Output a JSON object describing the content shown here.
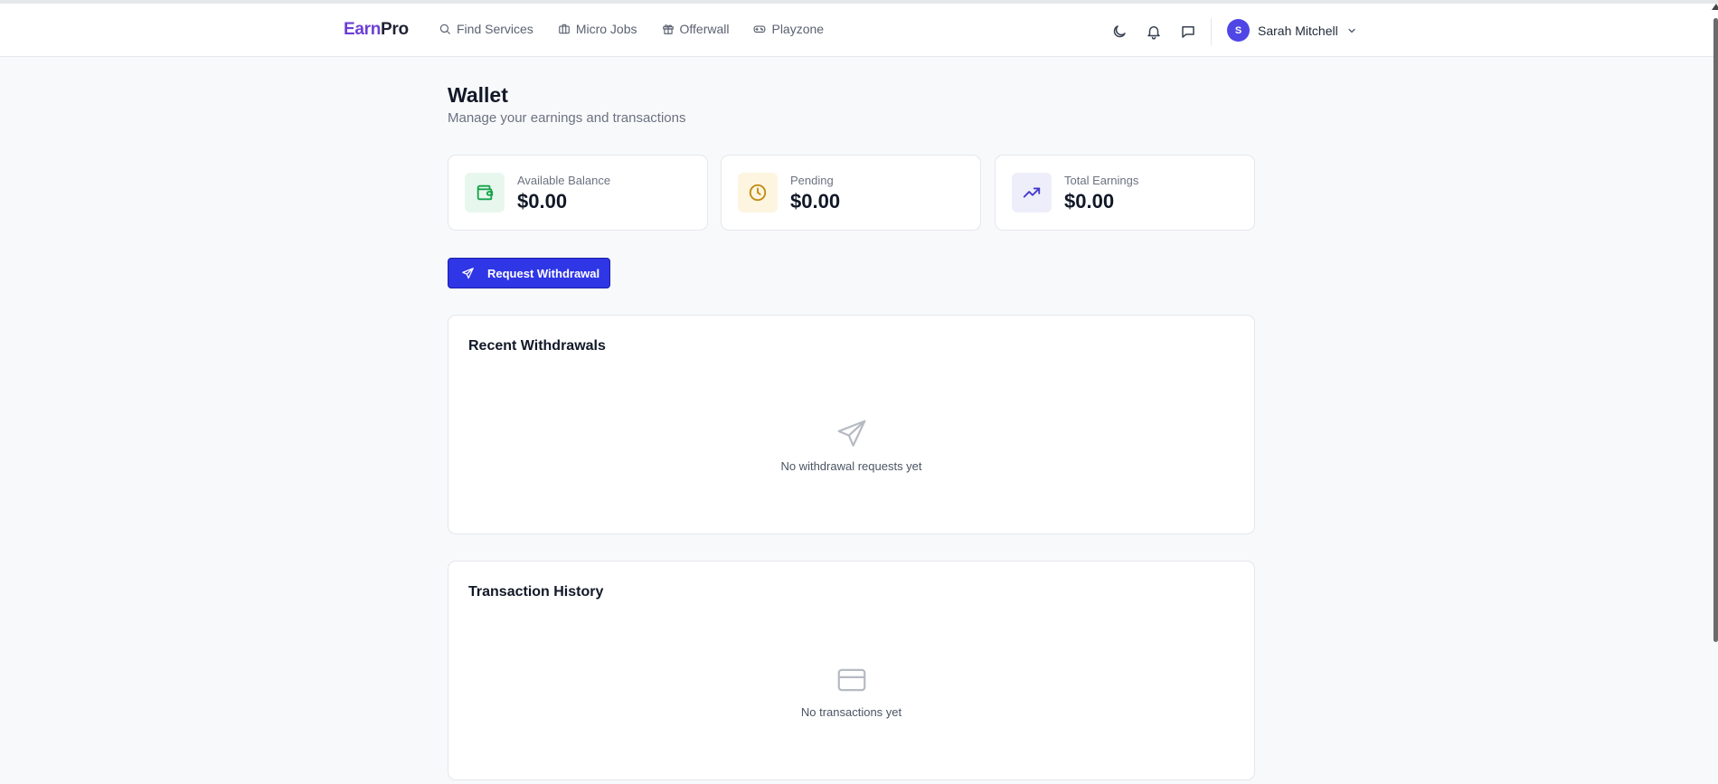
{
  "app": {
    "logo_part1": "Earn",
    "logo_part2": "Pro"
  },
  "nav": [
    {
      "label": "Find Services",
      "icon": "search-icon"
    },
    {
      "label": "Micro Jobs",
      "icon": "briefcase-icon"
    },
    {
      "label": "Offerwall",
      "icon": "gift-icon"
    },
    {
      "label": "Playzone",
      "icon": "gamepad-icon"
    }
  ],
  "header_actions": [
    "moon-icon",
    "bell-icon",
    "message-icon"
  ],
  "user": {
    "initial": "S",
    "name": "Sarah Mitchell"
  },
  "page": {
    "title": "Wallet",
    "subtitle": "Manage your earnings and transactions"
  },
  "stats": [
    {
      "label": "Available Balance",
      "value": "$0.00",
      "icon": "wallet-icon",
      "color": "#16a34a",
      "bg": "#e8f7ee"
    },
    {
      "label": "Pending",
      "value": "$0.00",
      "icon": "clock-icon",
      "color": "#c08a12",
      "bg": "#fdf5e0"
    },
    {
      "label": "Total Earnings",
      "value": "$0.00",
      "icon": "trending-up-icon",
      "color": "#4338ca",
      "bg": "#eeeefb"
    }
  ],
  "withdraw_button": {
    "label": "Request Withdrawal"
  },
  "recent_withdrawals": {
    "title": "Recent Withdrawals",
    "empty_text": "No withdrawal requests yet",
    "icon": "send-icon"
  },
  "transaction_history": {
    "title": "Transaction History",
    "empty_text": "No transactions yet",
    "icon": "credit-card-icon"
  },
  "colors": {
    "accent": "#2f36e6",
    "brand": "#6d3fd6"
  }
}
